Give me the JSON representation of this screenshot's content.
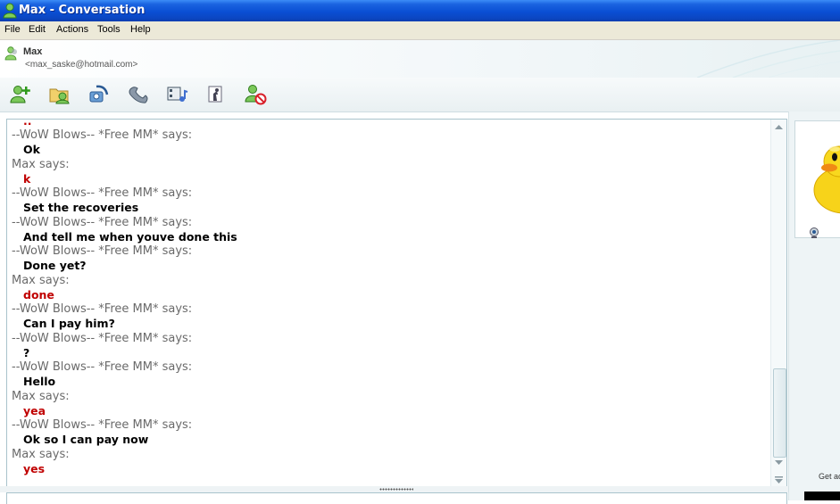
{
  "window": {
    "title": "Max - Conversation"
  },
  "menu": [
    "File",
    "Edit",
    "Actions",
    "Tools",
    "Help"
  ],
  "contact": {
    "name": "Max",
    "email": "<max_saske@hotmail.com>"
  },
  "toolbar": {
    "buttons": [
      {
        "icon": "invite-contact-icon"
      },
      {
        "icon": "send-files-icon"
      },
      {
        "icon": "video-call-icon"
      },
      {
        "icon": "phone-call-icon"
      },
      {
        "icon": "activities-icon"
      },
      {
        "icon": "games-icon"
      },
      {
        "icon": "block-contact-icon"
      }
    ]
  },
  "conversation": {
    "partial_top": "..",
    "lines": [
      {
        "sender": "--WoW Blows-- *Free MM* says:",
        "text": "Ok",
        "color": "#000000"
      },
      {
        "sender": "Max says:",
        "text": "k",
        "color": "#c00000"
      },
      {
        "sender": "--WoW Blows-- *Free MM* says:",
        "text": "Set the recoveries",
        "color": "#000000"
      },
      {
        "sender": "--WoW Blows-- *Free MM* says:",
        "text": "And tell me when youve done this",
        "color": "#000000"
      },
      {
        "sender": "--WoW Blows-- *Free MM* says:",
        "text": "Done yet?",
        "color": "#000000"
      },
      {
        "sender": "Max says:",
        "text": "done",
        "color": "#c00000"
      },
      {
        "sender": "--WoW Blows-- *Free MM* says:",
        "text": "Can I pay him?",
        "color": "#000000"
      },
      {
        "sender": "--WoW Blows-- *Free MM* says:",
        "text": "?",
        "color": "#000000"
      },
      {
        "sender": "--WoW Blows-- *Free MM* says:",
        "text": "Hello",
        "color": "#000000"
      },
      {
        "sender": "Max says:",
        "text": "yea",
        "color": "#c00000"
      },
      {
        "sender": "--WoW Blows-- *Free MM* says:",
        "text": "Ok so I can pay now",
        "color": "#000000"
      },
      {
        "sender": "Max says:",
        "text": "yes",
        "color": "#c00000"
      }
    ]
  },
  "sidebar": {
    "get_label": "Get ac"
  }
}
